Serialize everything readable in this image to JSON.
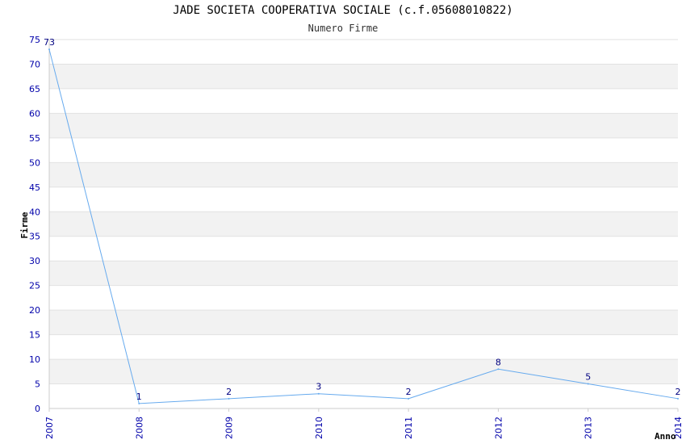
{
  "chart_data": {
    "type": "line",
    "title": "JADE SOCIETA COOPERATIVA SOCIALE (c.f.05608010822)",
    "subtitle": "Numero Firme",
    "xlabel": "Anno",
    "ylabel": "Firme",
    "categories": [
      "2007",
      "2008",
      "2009",
      "2010",
      "2011",
      "2012",
      "2013",
      "2014"
    ],
    "series": [
      {
        "values": [
          73,
          1,
          2,
          3,
          2,
          8,
          5,
          2
        ]
      }
    ],
    "ylim": [
      0,
      75
    ],
    "ytick_step": 5,
    "grid": true,
    "line_color": "#66aaee",
    "band_color": "#f2f2f2",
    "tick_color": "#0000aa",
    "label_color": "#000080"
  }
}
